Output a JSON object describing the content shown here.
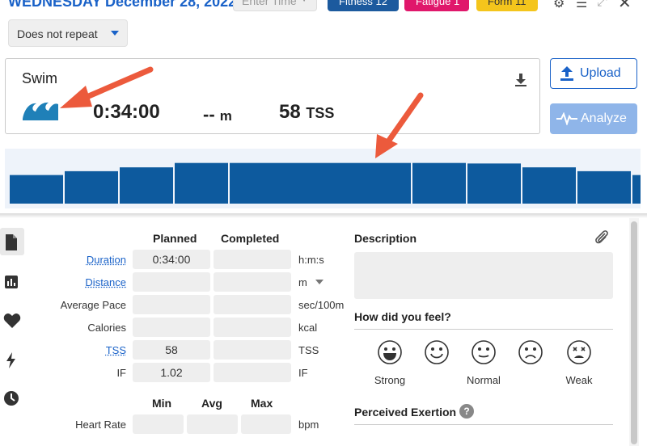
{
  "header": {
    "date": "WEDNESDAY December 28, 2022",
    "time_placeholder": "Enter Time",
    "fitness": "Fitness 12",
    "fatigue": "Fatigue 1",
    "form": "Form 11"
  },
  "repeat": {
    "value": "Does not repeat"
  },
  "workout": {
    "type": "Swim",
    "duration": "0:34:00",
    "distance_value": "--",
    "distance_unit": "m",
    "tss_value": "58",
    "tss_unit": "TSS",
    "icon": "swim-wave-icon"
  },
  "buttons": {
    "upload": "Upload",
    "analyze": "Analyze"
  },
  "intensity_profile": {
    "values": [
      0.52,
      0.59,
      0.66,
      0.74,
      0.74,
      0.74,
      0.73,
      0.66,
      0.59,
      0.52
    ],
    "color": "#0d5a9e"
  },
  "table": {
    "headers": {
      "planned": "Planned",
      "completed": "Completed"
    },
    "rows": [
      {
        "label": "Duration",
        "planned": "0:34:00",
        "completed": "",
        "unit": "h:m:s"
      },
      {
        "label": "Distance",
        "planned": "",
        "completed": "",
        "unit": "m"
      },
      {
        "label": "Average Pace",
        "planned": "",
        "completed": "",
        "unit": "sec/100m"
      },
      {
        "label": "Calories",
        "planned": "",
        "completed": "",
        "unit": "kcal"
      },
      {
        "label": "TSS",
        "planned": "58",
        "completed": "",
        "unit": "TSS"
      },
      {
        "label": "IF",
        "planned": "1.02",
        "completed": "",
        "unit": "IF"
      }
    ],
    "mma_headers": {
      "min": "Min",
      "avg": "Avg",
      "max": "Max"
    },
    "heart_rate": {
      "label": "Heart Rate",
      "min": "",
      "avg": "",
      "max": "",
      "unit": "bpm"
    }
  },
  "right_panel": {
    "description_title": "Description",
    "feel_title": "How did you feel?",
    "feelings": [
      "Strong",
      "",
      "Normal",
      "",
      "Weak"
    ],
    "exertion_title": "Perceived Exertion",
    "help": "?"
  },
  "colors": {
    "accent": "#1a62c8",
    "fitness": "#1c5a9e",
    "fatigue": "#e0176b",
    "form": "#f4c51c",
    "bar": "#0d5a9e",
    "arrow": "#ec5a3c"
  }
}
